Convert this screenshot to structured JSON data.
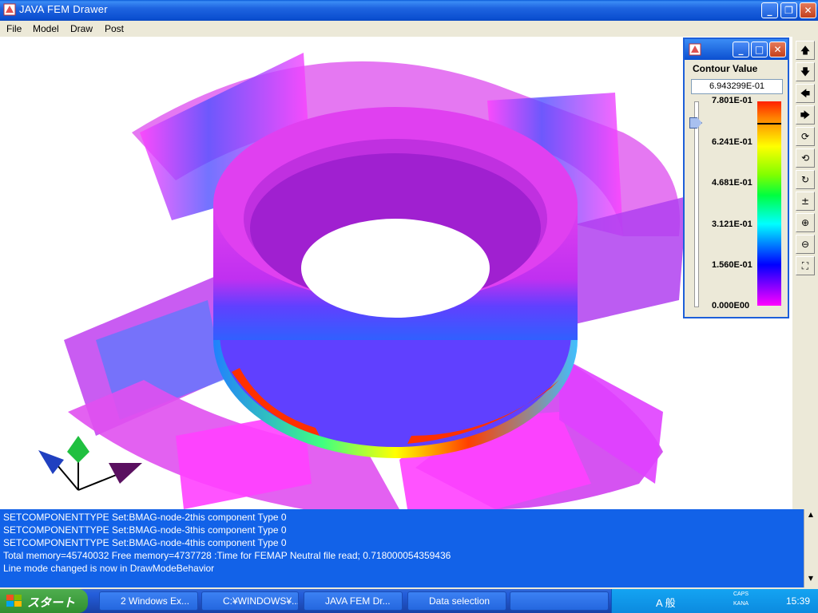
{
  "window": {
    "title": "JAVA FEM Drawer",
    "min": "_",
    "max": "❐",
    "close": "✕"
  },
  "menu": [
    "File",
    "Model",
    "Draw",
    "Post"
  ],
  "contour": {
    "label": "Contour Value",
    "value": "6.943299E-01",
    "ticks": [
      "7.801E-01",
      "6.241E-01",
      "4.681E-01",
      "3.121E-01",
      "1.560E-01",
      "0.000E00"
    ],
    "win_min": "_",
    "win_max": "□",
    "win_close": "✕"
  },
  "tools": [
    "🡅",
    "🡇",
    "🡄",
    "🡆",
    "⟳",
    "⟲",
    "↻",
    "±",
    "⊕",
    "⊖",
    "⛶"
  ],
  "console": [
    "SETCOMPONENTTYPE Set:BMAG-node-2this component Type 0",
    "SETCOMPONENTTYPE Set:BMAG-node-3this component Type 0",
    "SETCOMPONENTTYPE Set:BMAG-node-4this component Type 0",
    "Total memory=45740032 Free memory=4737728 :Time for FEMAP Neutral file read; 0.718000054359436",
    "Line mode changed  is now in DrawModeBehavior"
  ],
  "taskbar": {
    "start": "スタート",
    "tasks": [
      "2 Windows Ex...",
      "C:¥WINDOWS¥...",
      "JAVA FEM Dr...",
      "Data selection",
      ""
    ],
    "clock": "15:39",
    "caps": "CAPS",
    "kana": "KANA",
    "ime": "A 般"
  },
  "colors": {
    "accent": "#0b4fd0",
    "console_bg": "#1262e8",
    "magenta": "#ff00ff"
  }
}
